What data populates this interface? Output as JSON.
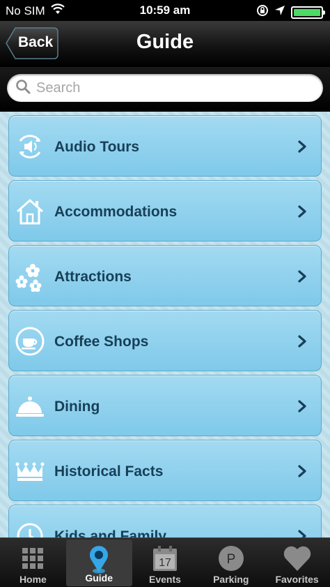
{
  "status_bar": {
    "carrier": "No SIM",
    "time": "10:59 am"
  },
  "nav": {
    "title": "Guide",
    "back_label": "Back"
  },
  "search": {
    "placeholder": "Search",
    "value": ""
  },
  "list": {
    "items": [
      {
        "label": "Audio Tours",
        "icon": "audio-tour-icon"
      },
      {
        "label": "Accommodations",
        "icon": "house-icon"
      },
      {
        "label": "Attractions",
        "icon": "flowers-icon"
      },
      {
        "label": "Coffee Shops",
        "icon": "coffee-cup-icon"
      },
      {
        "label": "Dining",
        "icon": "cloche-icon"
      },
      {
        "label": "Historical Facts",
        "icon": "crown-icon"
      },
      {
        "label": "Kids and Family",
        "icon": "clock-icon"
      }
    ]
  },
  "tab_bar": {
    "tabs": [
      {
        "label": "Home",
        "icon": "grid-icon",
        "active": false
      },
      {
        "label": "Guide",
        "icon": "map-pin-icon",
        "active": true
      },
      {
        "label": "Events",
        "icon": "calendar-icon",
        "active": false,
        "badge_text": "17"
      },
      {
        "label": "Parking",
        "icon": "parking-icon",
        "active": false,
        "badge_text": "P"
      },
      {
        "label": "Favorites",
        "icon": "heart-icon",
        "active": false
      }
    ]
  },
  "colors": {
    "list_item_bg": "#8fd0ee",
    "list_text": "#173f57",
    "battery_fill": "#4cd964"
  }
}
